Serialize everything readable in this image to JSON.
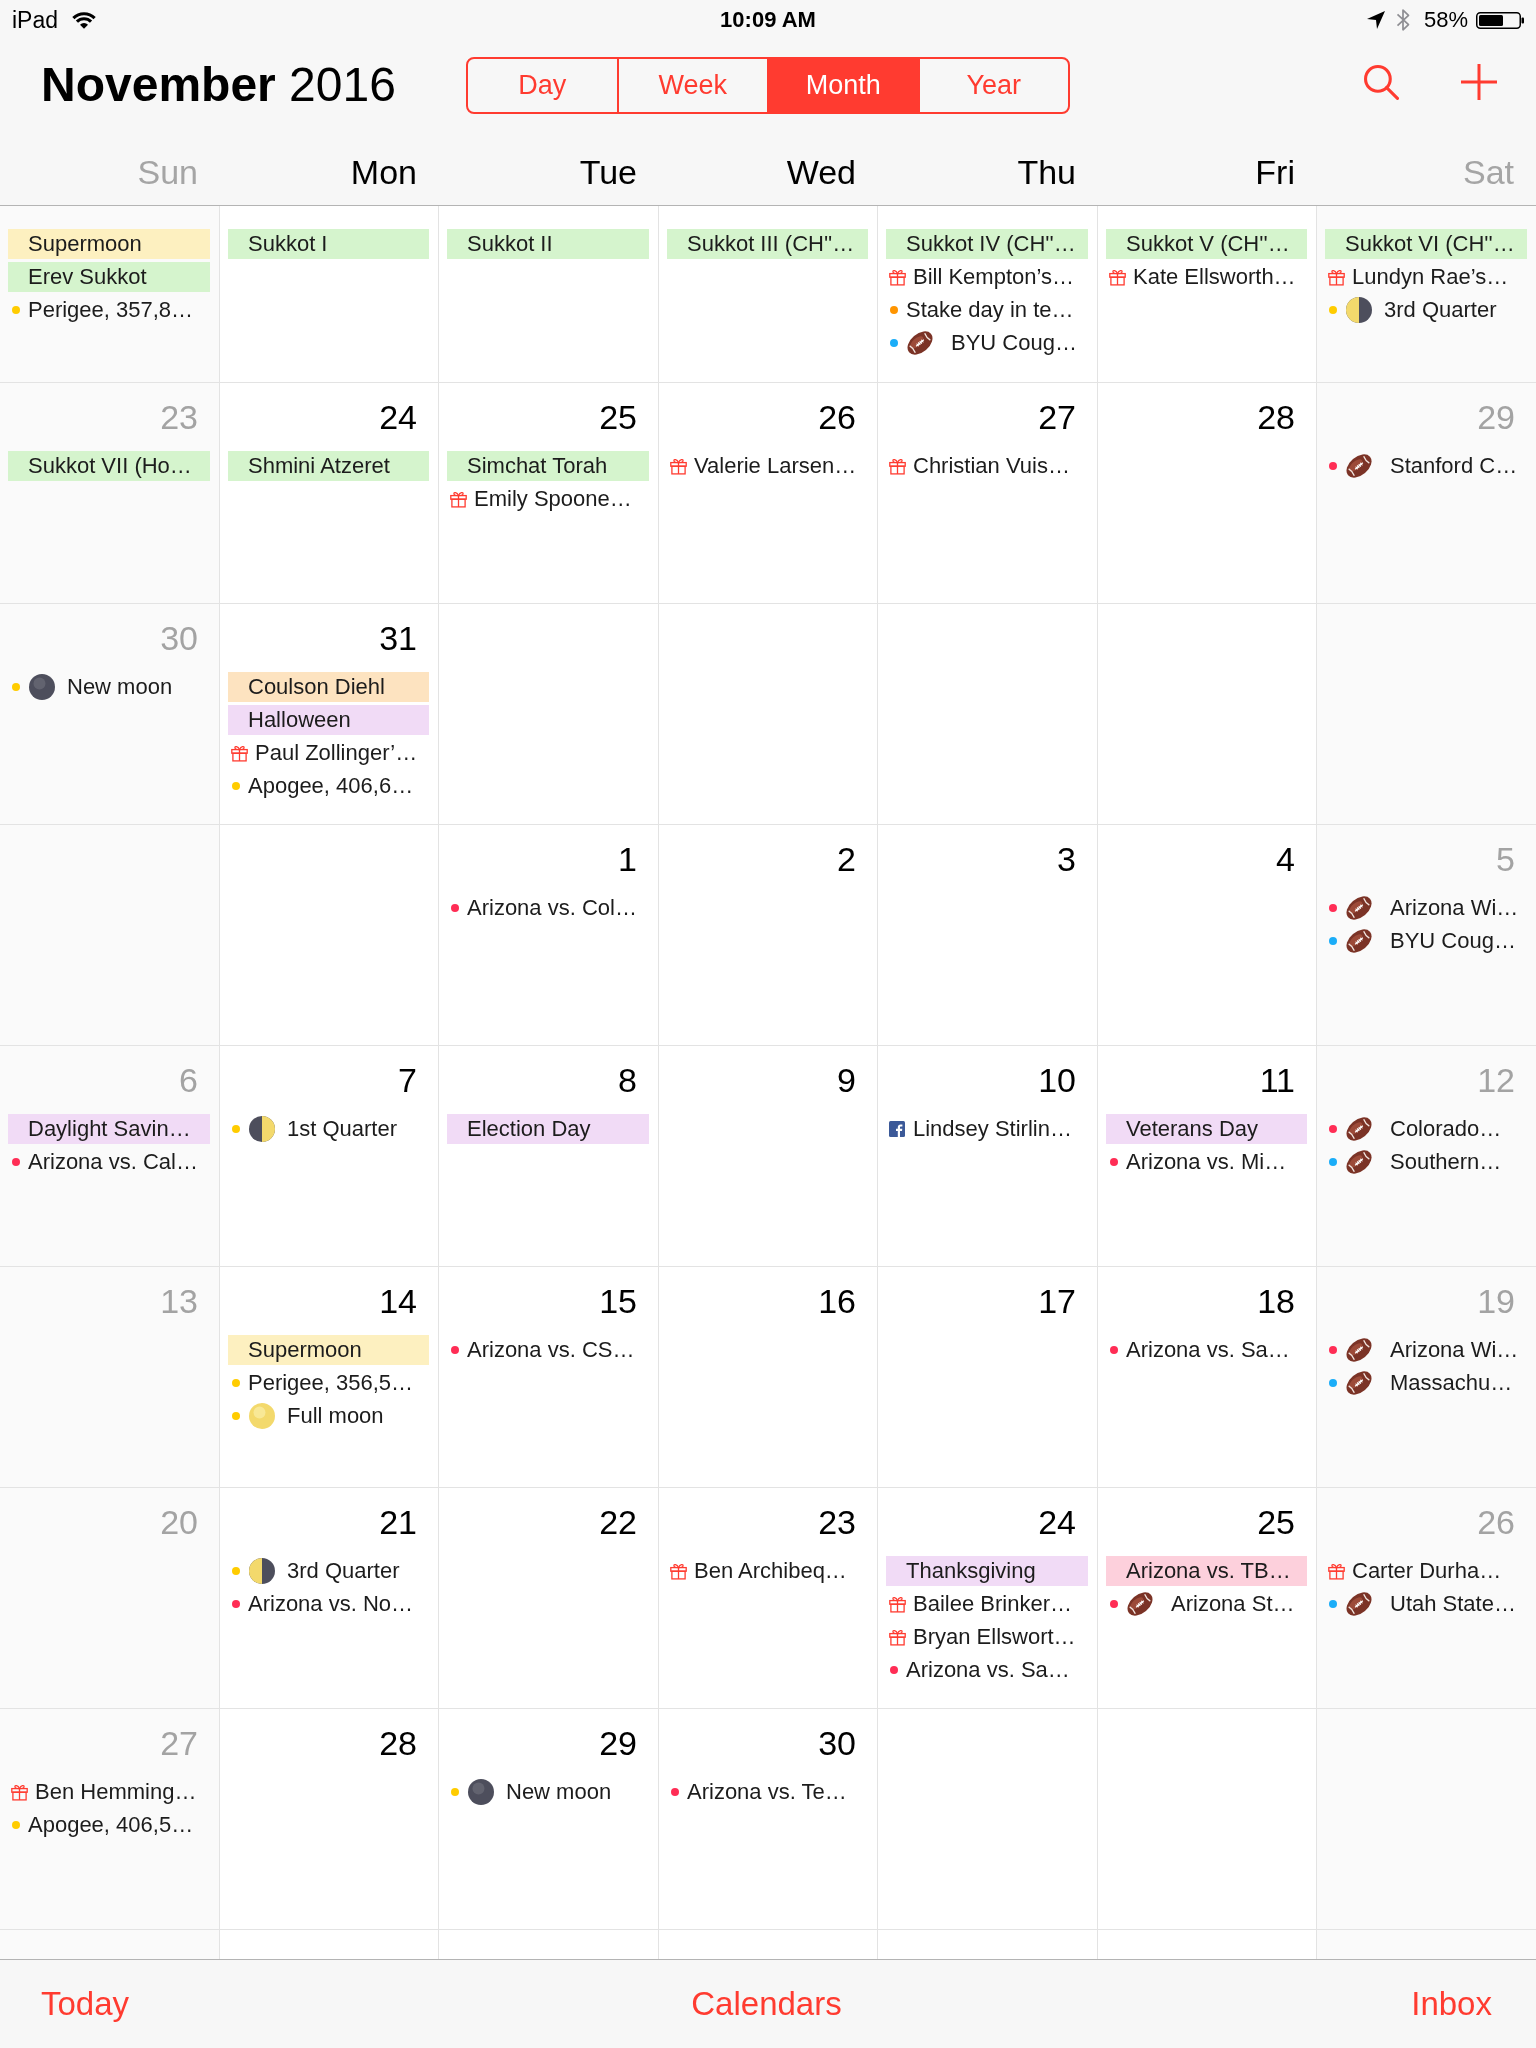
{
  "status_bar": {
    "carrier": "iPad",
    "time": "10:09 AM",
    "battery": "58%"
  },
  "header": {
    "title": "**November** 2016",
    "views": [
      {
        "label": "Day",
        "selected": false
      },
      {
        "label": "Week",
        "selected": false
      },
      {
        "label": "Month",
        "selected": true
      },
      {
        "label": "Year",
        "selected": false
      }
    ]
  },
  "weekdays": [
    {
      "label": "Sun",
      "weekend": true
    },
    {
      "label": "Mon",
      "weekend": false
    },
    {
      "label": "Tue",
      "weekend": false
    },
    {
      "label": "Wed",
      "weekend": false
    },
    {
      "label": "Thu",
      "weekend": false
    },
    {
      "label": "Fri",
      "weekend": false
    },
    {
      "label": "Sat",
      "weekend": true
    }
  ],
  "weeks": [
    {
      "kind": "full",
      "days": [
        {
          "events": [
            {
              "kind": "bar",
              "title": "Supermoon",
              "color": "#fdf0c0"
            },
            {
              "kind": "bar",
              "title": "Erev Sukkot",
              "color": "#d5f4cd"
            },
            {
              "kind": "dot",
              "title": "Perigee, 357,8…",
              "color": "#ffcc00"
            }
          ]
        },
        {
          "events": [
            {
              "kind": "bar",
              "title": "Sukkot I",
              "color": "#d5f4cd"
            }
          ]
        },
        {
          "events": [
            {
              "kind": "bar",
              "title": "Sukkot II",
              "color": "#d5f4cd"
            }
          ]
        },
        {
          "events": [
            {
              "kind": "bar",
              "title": "Sukkot III (CH''…",
              "color": "#d5f4cd"
            }
          ]
        },
        {
          "events": [
            {
              "kind": "bar",
              "title": "Sukkot IV (CH''…",
              "color": "#d5f4cd"
            },
            {
              "kind": "birthday",
              "title": "Bill Kempton’s…"
            },
            {
              "kind": "dot",
              "title": "Stake day in te…",
              "color": "#ff9500"
            },
            {
              "kind": "football",
              "title": "BYU Coug…",
              "color": "#1badf8"
            }
          ]
        },
        {
          "events": [
            {
              "kind": "bar",
              "title": "Sukkot V (CH''…",
              "color": "#d5f4cd"
            },
            {
              "kind": "birthday",
              "title": "Kate Ellsworth…"
            }
          ]
        },
        {
          "events": [
            {
              "kind": "bar",
              "title": "Sukkot VI (CH''…",
              "color": "#d5f4cd"
            },
            {
              "kind": "birthday",
              "title": "Lundyn Rae’s…"
            },
            {
              "kind": "third_quarter",
              "title": "3rd Quarter",
              "color": "#ffcc00"
            }
          ]
        }
      ]
    },
    {
      "kind": "full",
      "days": [
        {
          "date": "23",
          "events": [
            {
              "kind": "bar",
              "title": "Sukkot VII (Ho…",
              "color": "#d5f4cd"
            }
          ]
        },
        {
          "date": "24",
          "events": [
            {
              "kind": "bar",
              "title": "Shmini Atzeret",
              "color": "#d5f4cd"
            }
          ]
        },
        {
          "date": "25",
          "events": [
            {
              "kind": "bar",
              "title": "Simchat Torah",
              "color": "#d5f4cd"
            },
            {
              "kind": "birthday",
              "title": "Emily Spoone…"
            }
          ]
        },
        {
          "date": "26",
          "events": [
            {
              "kind": "birthday",
              "title": "Valerie Larsen…"
            }
          ]
        },
        {
          "date": "27",
          "events": [
            {
              "kind": "birthday",
              "title": "Christian Vuis…"
            }
          ]
        },
        {
          "date": "28"
        },
        {
          "date": "29",
          "events": [
            {
              "kind": "football",
              "title": "Stanford C…",
              "color": "#ff2d55"
            }
          ]
        }
      ]
    },
    {
      "kind": "month_end",
      "days": [
        {
          "date": "30",
          "events": [
            {
              "kind": "new_moon",
              "title": "New moon",
              "color": "#ffcc00"
            }
          ]
        },
        {
          "date": "31",
          "events": [
            {
              "kind": "bar",
              "title": "Coulson Diehl",
              "color": "#fde3c0"
            },
            {
              "kind": "bar",
              "title": "Halloween",
              "color": "#f1dbf6"
            },
            {
              "kind": "birthday",
              "title": "Paul Zollinger’…"
            },
            {
              "kind": "dot",
              "title": "Apogee, 406,6…",
              "color": "#ffcc00"
            }
          ]
        }
      ]
    },
    {
      "kind": "month_start",
      "days": [
        {
          "date": "1",
          "events": [
            {
              "kind": "dot",
              "title": "Arizona vs. Col…",
              "color": "#ff2d55"
            }
          ]
        },
        {
          "date": "2"
        },
        {
          "date": "3"
        },
        {
          "date": "4"
        },
        {
          "date": "5",
          "events": [
            {
              "kind": "football",
              "title": "Arizona Wi…",
              "color": "#ff2d55"
            },
            {
              "kind": "football",
              "title": "BYU Coug…",
              "color": "#1badf8"
            }
          ]
        }
      ]
    },
    {
      "kind": "full",
      "days": [
        {
          "date": "6",
          "events": [
            {
              "kind": "bar",
              "title": "Daylight Savin…",
              "color": "#f1dbf6"
            },
            {
              "kind": "dot",
              "title": "Arizona vs. Cal…",
              "color": "#ff2d55"
            }
          ]
        },
        {
          "date": "7",
          "events": [
            {
              "kind": "first_quarter",
              "title": "1st Quarter",
              "color": "#ffcc00"
            }
          ]
        },
        {
          "date": "8",
          "events": [
            {
              "kind": "bar",
              "title": "Election Day",
              "color": "#f1dbf6"
            }
          ]
        },
        {
          "date": "9"
        },
        {
          "date": "10",
          "events": [
            {
              "kind": "facebook",
              "title": "Lindsey Stirlin…"
            }
          ]
        },
        {
          "date": "11",
          "events": [
            {
              "kind": "bar",
              "title": "Veterans Day",
              "color": "#f1dbf6"
            },
            {
              "kind": "dot",
              "title": "Arizona vs. Mi…",
              "color": "#ff2d55"
            }
          ]
        },
        {
          "date": "12",
          "events": [
            {
              "kind": "football",
              "title": "Colorado…",
              "color": "#ff2d55"
            },
            {
              "kind": "football",
              "title": "Southern…",
              "color": "#1badf8"
            }
          ]
        }
      ]
    },
    {
      "kind": "full",
      "days": [
        {
          "date": "13"
        },
        {
          "date": "14",
          "events": [
            {
              "kind": "bar",
              "title": "Supermoon",
              "color": "#fdf0c0"
            },
            {
              "kind": "dot",
              "title": "Perigee, 356,5…",
              "color": "#ffcc00"
            },
            {
              "kind": "full_moon",
              "title": "Full moon",
              "color": "#ffcc00"
            }
          ]
        },
        {
          "date": "15",
          "events": [
            {
              "kind": "dot",
              "title": "Arizona vs. CS…",
              "color": "#ff2d55"
            }
          ]
        },
        {
          "date": "16"
        },
        {
          "date": "17"
        },
        {
          "date": "18",
          "events": [
            {
              "kind": "dot",
              "title": "Arizona vs. Sa…",
              "color": "#ff2d55"
            }
          ]
        },
        {
          "date": "19",
          "events": [
            {
              "kind": "football",
              "title": "Arizona Wi…",
              "color": "#ff2d55"
            },
            {
              "kind": "football",
              "title": "Massachu…",
              "color": "#1badf8"
            }
          ]
        }
      ]
    },
    {
      "kind": "full",
      "days": [
        {
          "date": "20"
        },
        {
          "date": "21",
          "events": [
            {
              "kind": "third_quarter",
              "title": "3rd Quarter",
              "color": "#ffcc00"
            },
            {
              "kind": "dot",
              "title": "Arizona vs. No…",
              "color": "#ff2d55"
            }
          ]
        },
        {
          "date": "22"
        },
        {
          "date": "23",
          "events": [
            {
              "kind": "birthday",
              "title": "Ben Archibeq…"
            }
          ]
        },
        {
          "date": "24",
          "events": [
            {
              "kind": "bar",
              "title": "Thanksgiving",
              "color": "#f1dbf6"
            },
            {
              "kind": "birthday",
              "title": "Bailee Brinker…"
            },
            {
              "kind": "birthday",
              "title": "Bryan Ellswort…"
            },
            {
              "kind": "dot",
              "title": "Arizona vs. Sa…",
              "color": "#ff2d55"
            }
          ]
        },
        {
          "date": "25",
          "events": [
            {
              "kind": "bar",
              "title": "Arizona vs. TB…",
              "color": "#fdd0dc"
            },
            {
              "kind": "football",
              "title": "Arizona St…",
              "color": "#ff2d55"
            }
          ]
        },
        {
          "date": "26",
          "events": [
            {
              "kind": "birthday",
              "title": "Carter Durha…"
            },
            {
              "kind": "football",
              "title": "Utah State…",
              "color": "#1badf8"
            }
          ]
        }
      ]
    },
    {
      "kind": "month_end",
      "days": [
        {
          "date": "27",
          "events": [
            {
              "kind": "birthday",
              "title": "Ben Hemming…"
            },
            {
              "kind": "dot",
              "title": "Apogee, 406,5…",
              "color": "#ffcc00"
            }
          ]
        },
        {
          "date": "28"
        },
        {
          "date": "29",
          "events": [
            {
              "kind": "new_moon",
              "title": "New moon",
              "color": "#ffcc00"
            }
          ]
        },
        {
          "date": "30",
          "events": [
            {
              "kind": "dot",
              "title": "Arizona vs. Te…",
              "color": "#ff2d55"
            }
          ]
        }
      ]
    }
  ],
  "toolbar": [
    {
      "label": "Today"
    },
    {
      "label": "Calendars"
    },
    {
      "label": "Inbox"
    }
  ]
}
